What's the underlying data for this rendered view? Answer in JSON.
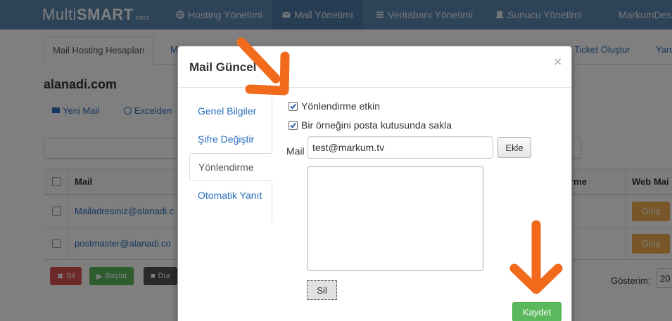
{
  "navbar": {
    "brand_light": "Multi",
    "brand_bold": "SMART",
    "brand_tag": "beta",
    "items": [
      {
        "label": "Hosting Yönetimi",
        "icon": "globe-icon"
      },
      {
        "label": "Mail Yönetimi",
        "icon": "envelope-icon"
      },
      {
        "label": "Veritabanı Yönetimi",
        "icon": "database-icon"
      },
      {
        "label": "Sunucu Yönetimi",
        "icon": "server-icon"
      },
      {
        "label": "MarkumDes"
      }
    ]
  },
  "page": {
    "tabs": [
      "Mail Hosting Hesapları",
      "M",
      "Ticket Oluştur",
      "Yard"
    ],
    "domain": "alanadi.com",
    "actions": [
      "Yeni Mail",
      "Excelden"
    ],
    "table": {
      "headers": [
        "Mail",
        "rme",
        "Web Mai"
      ],
      "rows": [
        {
          "mail": "Mailadresiniz@alanadi.c",
          "webmail": "Giriş"
        },
        {
          "mail": "postmaster@alanadi.co",
          "webmail": "Giriş"
        }
      ]
    },
    "bottom_buttons": [
      "Sil",
      "Başlat",
      "Dur"
    ],
    "gosterim_label": "Gösterim:",
    "gosterim_value": "20"
  },
  "modal": {
    "title": "Mail Güncel",
    "close": "×",
    "tabs": [
      "Genel Bilgiler",
      "Şifre Değiştir",
      "Yönlendirme",
      "Otomatik Yanıt"
    ],
    "active_tab": 2,
    "forwarding_enabled_label": "Yönlendirme etkin",
    "keep_copy_label": "Bir örneğini posta kutusunda sakla",
    "mail_label": "Mail",
    "mail_value": "test@markum.tv",
    "add_label": "Ekle",
    "delete_label": "Sil",
    "save_label": "Kaydet"
  },
  "colors": {
    "navbar": "#5b86b1",
    "link": "#2a6ebb",
    "save": "#5cb85c",
    "webmail": "#f0ad4e",
    "arrow": "#f26a1b"
  }
}
